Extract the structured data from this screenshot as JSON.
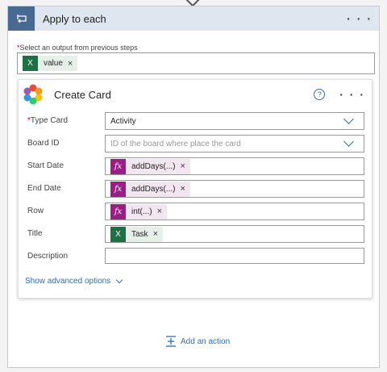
{
  "scope": {
    "title": "Apply to each",
    "menu": "· · ·",
    "select_label": "Select an output from previous steps",
    "select_token": "value"
  },
  "card": {
    "title": "Create Card",
    "help": "?",
    "menu": "· · ·",
    "fields": {
      "type_card": {
        "label": "Type Card",
        "value": "Activity"
      },
      "board_id": {
        "label": "Board ID",
        "placeholder": "ID of the board where place the card"
      },
      "start_date": {
        "label": "Start Date",
        "token": "addDays(...)"
      },
      "end_date": {
        "label": "End Date",
        "token": "addDays(...)"
      },
      "row": {
        "label": "Row",
        "token": "int(...)"
      },
      "title": {
        "label": "Title",
        "token": "Task"
      },
      "description": {
        "label": "Description",
        "value": ""
      }
    },
    "advanced": "Show advanced options"
  },
  "add_action": "Add an action",
  "token_glyphs": {
    "excel": "X",
    "fx": "fx",
    "remove": "×"
  },
  "colors": {
    "header_bg": "#dfe6f0",
    "header_icon_bg": "#486991",
    "link": "#2a6ebb",
    "excel": "#1e7145",
    "expression": "#9b1d87"
  }
}
